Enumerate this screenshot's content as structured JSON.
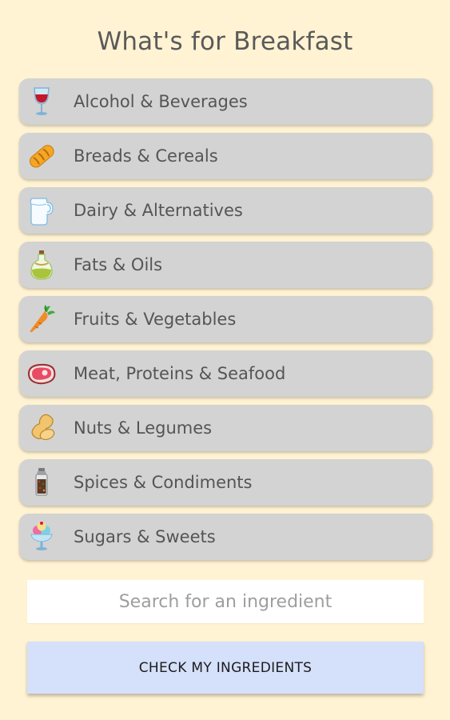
{
  "header": {
    "title": "What's for Breakfast"
  },
  "categories": [
    {
      "label": "Alcohol & Beverages",
      "icon": "wine-glass-icon"
    },
    {
      "label": "Breads & Cereals",
      "icon": "bread-icon"
    },
    {
      "label": "Dairy & Alternatives",
      "icon": "milk-jug-icon"
    },
    {
      "label": "Fats & Oils",
      "icon": "oil-bottle-icon"
    },
    {
      "label": "Fruits & Vegetables",
      "icon": "carrot-icon"
    },
    {
      "label": "Meat, Proteins & Seafood",
      "icon": "steak-icon"
    },
    {
      "label": "Nuts & Legumes",
      "icon": "peanut-icon"
    },
    {
      "label": "Spices & Condiments",
      "icon": "spice-grinder-icon"
    },
    {
      "label": "Sugars & Sweets",
      "icon": "ice-cream-sundae-icon"
    }
  ],
  "search": {
    "placeholder": "Search for an ingredient",
    "value": ""
  },
  "actions": {
    "check_label": "CHECK MY INGREDIENTS"
  },
  "colors": {
    "background": "#fff3d3",
    "category_bg": "#d3d3d3",
    "button_bg": "#d5e0fb"
  }
}
